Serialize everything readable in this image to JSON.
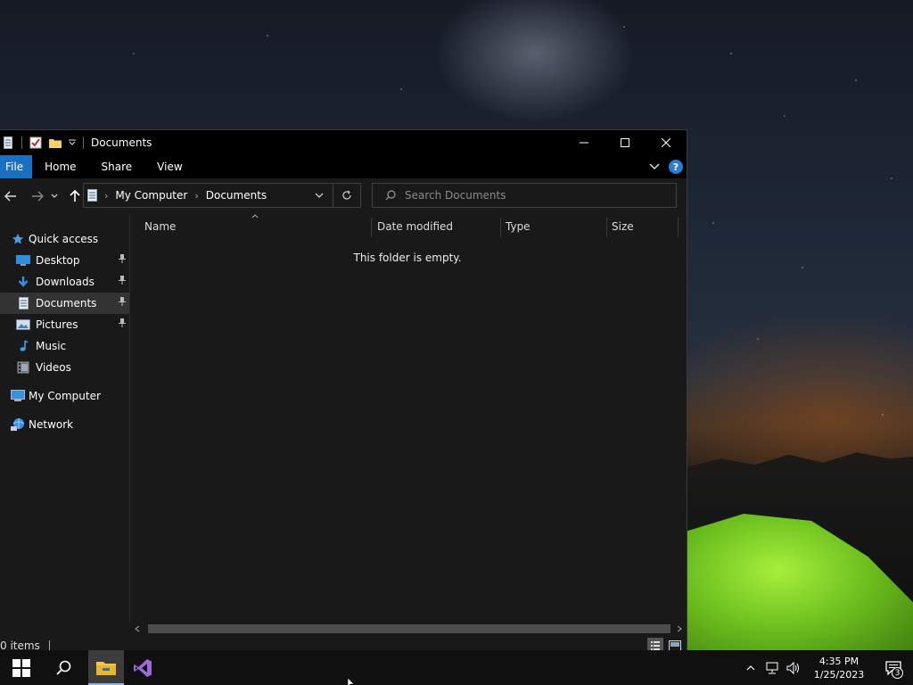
{
  "window": {
    "title": "Documents",
    "controls": {
      "minimize": "—",
      "maximize": "☐",
      "close": "✕"
    }
  },
  "ribbon": {
    "tabs": [
      "File",
      "Home",
      "Share",
      "View"
    ],
    "help": "?"
  },
  "navigation": {
    "breadcrumb": [
      "My Computer",
      "Documents"
    ],
    "search_placeholder": "Search Documents"
  },
  "sidebar": {
    "quick_access": "Quick access",
    "items": [
      {
        "label": "Desktop",
        "icon": "desktop-icon",
        "pinned": true
      },
      {
        "label": "Downloads",
        "icon": "downloads-icon",
        "pinned": true
      },
      {
        "label": "Documents",
        "icon": "documents-icon",
        "pinned": true,
        "selected": true
      },
      {
        "label": "Pictures",
        "icon": "pictures-icon",
        "pinned": true
      },
      {
        "label": "Music",
        "icon": "music-icon",
        "pinned": false
      },
      {
        "label": "Videos",
        "icon": "videos-icon",
        "pinned": false
      }
    ],
    "my_computer": "My Computer",
    "network": "Network"
  },
  "files": {
    "columns": [
      "Name",
      "Date modified",
      "Type",
      "Size"
    ],
    "empty_message": "This folder is empty."
  },
  "status": {
    "item_count": "0 items"
  },
  "taskbar": {
    "time": "4:35 PM",
    "date": "1/25/2023",
    "notification_count": "3",
    "pinned_apps": [
      "start-icon",
      "search-icon",
      "file-explorer-icon",
      "visual-studio-icon"
    ]
  },
  "colors": {
    "accent": "#1a6fc1",
    "window_bg": "#191919",
    "titlebar_bg": "#000000",
    "selected_bg": "#333333"
  }
}
